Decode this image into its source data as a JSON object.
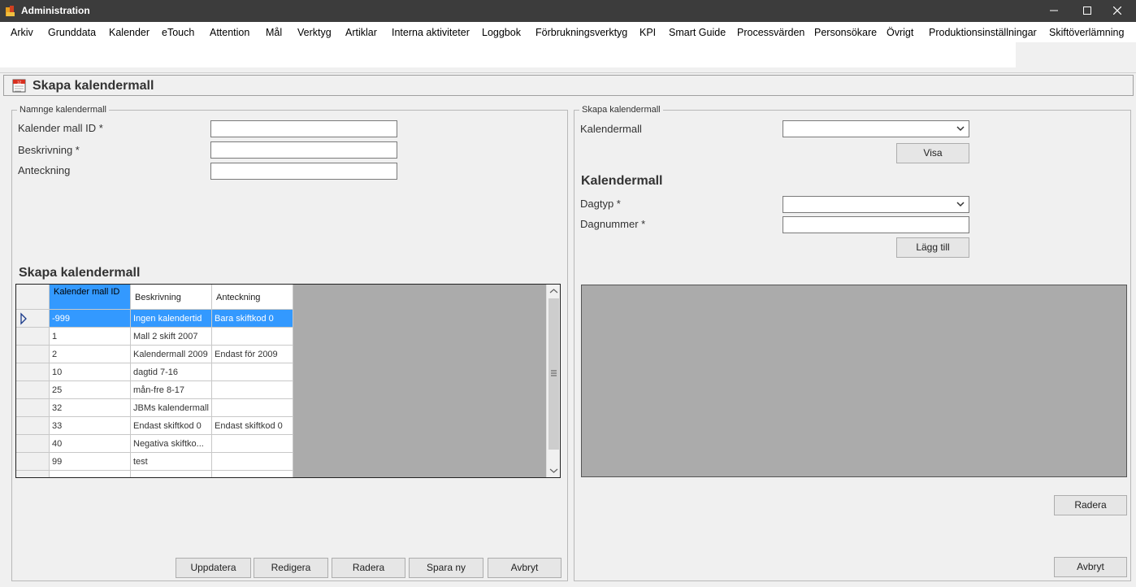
{
  "window": {
    "title": "Administration",
    "minimize": "—",
    "maximize": "☐",
    "close": "✕"
  },
  "menu": [
    "Arkiv",
    "Grunddata",
    "Kalender",
    "eTouch",
    "Attention",
    "Mål",
    "Verktyg",
    "Artiklar",
    "Interna aktiviteter",
    "Loggbok",
    "Förbrukningsverktyg",
    "KPI",
    "Smart Guide",
    "Processvärden",
    "Personsökare",
    "Övrigt",
    "Produktionsinställningar",
    "Skiftöverlämning"
  ],
  "page": {
    "title": "Skapa kalendermall"
  },
  "left_group": {
    "legend": "Namnge kalendermall",
    "id_label": "Kalender mall ID *",
    "id_value": "",
    "desc_label": "Beskrivning *",
    "desc_value": "",
    "note_label": "Anteckning",
    "note_value": "",
    "grid_title": "Skapa kalendermall",
    "columns": [
      "Kalender mall ID",
      "Beskrivning",
      "Anteckning"
    ],
    "rows": [
      {
        "id": "-999",
        "desc": "Ingen kalendertid",
        "note": "Bara skiftkod 0"
      },
      {
        "id": "1",
        "desc": "Mall 2 skift 2007",
        "note": ""
      },
      {
        "id": "2",
        "desc": "Kalendermall 2009",
        "note": "Endast för 2009"
      },
      {
        "id": "10",
        "desc": "dagtid 7-16",
        "note": ""
      },
      {
        "id": "25",
        "desc": "mån-fre 8-17",
        "note": ""
      },
      {
        "id": "32",
        "desc": "JBMs kalendermall",
        "note": ""
      },
      {
        "id": "33",
        "desc": "Endast skiftkod 0",
        "note": "Endast skiftkod 0"
      },
      {
        "id": "40",
        "desc": "Negativa skiftko...",
        "note": ""
      },
      {
        "id": "99",
        "desc": "test",
        "note": ""
      }
    ],
    "buttons": {
      "update": "Uppdatera",
      "edit": "Redigera",
      "delete": "Radera",
      "save_new": "Spara ny",
      "cancel": "Avbryt"
    }
  },
  "right_group": {
    "legend": "Skapa kalendermall",
    "template_label": "Kalendermall",
    "template_value": "",
    "show_button": "Visa",
    "section_title": "Kalendermall",
    "daytype_label": "Dagtyp *",
    "daytype_value": "",
    "daynum_label": "Dagnummer *",
    "daynum_value": "",
    "add_button": "Lägg till",
    "delete_button": "Radera",
    "cancel_button": "Avbryt"
  }
}
